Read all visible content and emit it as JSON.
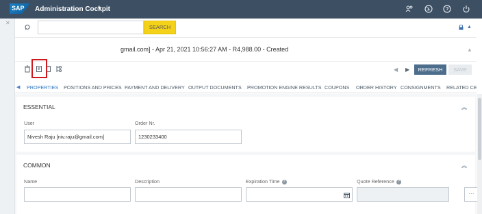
{
  "shell": {
    "logo": "SAP",
    "app_title": "Administration Cockpit",
    "caret": "▾",
    "icons": [
      "users-icon",
      "globe-icon",
      "help-icon",
      "power-icon"
    ]
  },
  "search": {
    "placeholder": "",
    "button_label": "SEARCH"
  },
  "header": {
    "title_visible": "gmail.com] - Apr 21, 2021 10:56:27 AM - R4,988.00 - Created"
  },
  "toolbar": {
    "refresh_label": "REFRESH",
    "save_label": "SAVE"
  },
  "tabs": [
    {
      "label": "PROPERTIES",
      "active": true
    },
    {
      "label": "POSITIONS AND PRICES"
    },
    {
      "label": "PAYMENT AND DELIVERY"
    },
    {
      "label": "OUTPUT DOCUMENTS"
    },
    {
      "label": "PROMOTION ENGINE RESULTS"
    },
    {
      "label": "COUPONS"
    },
    {
      "label": "ORDER HISTORY"
    },
    {
      "label": "CONSIGNMENTS"
    },
    {
      "label": "RELATED CE"
    }
  ],
  "essential": {
    "title": "ESSENTIAL",
    "user_label": "User",
    "user_value": "Nivesh Raju [niv.raju@gmail.com]",
    "order_label": "Order Nr.",
    "order_value": "1230233400"
  },
  "common": {
    "title": "COMMON",
    "name_label": "Name",
    "description_label": "Description",
    "expiration_label": "Expiration Time",
    "quote_label": "Quote Reference",
    "ellipsis": "···"
  },
  "colors": {
    "shell_bg": "#3c4f63",
    "search_button": "#f5d21a",
    "refresh_button": "#4c6d8b",
    "accent": "#2f78c3",
    "highlight": "#d0191c"
  }
}
